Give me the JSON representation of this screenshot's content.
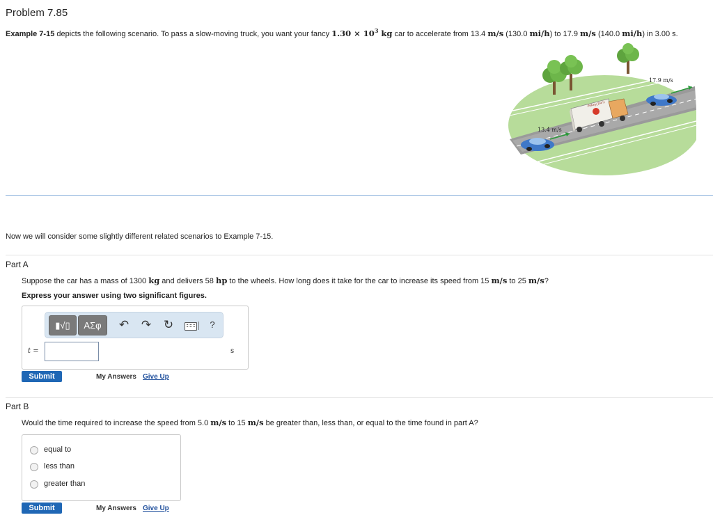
{
  "problem_title": "Problem 7.85",
  "intro": {
    "example_ref": "Example 7-15",
    "text_1": " depicts the following scenario. To pass a slow-moving truck, you want your fancy ",
    "mass": "1.30 × 10",
    "mass_exp": "3",
    "mass_unit": " kg",
    "text_2": " car to accelerate from 13.4 ",
    "ms_1": "m/s",
    "text_3": " (130.0 ",
    "mih_1": "mi/h",
    "text_4": ") to 17.9 ",
    "ms_2": "m/s",
    "text_5": " (140.0 ",
    "mih_2": "mi/h",
    "text_6": ") in 3.00 s."
  },
  "figure": {
    "speed_start": "13.4 m/s",
    "speed_end": "17.9 m/s",
    "truck_label": "Pokey Joe's"
  },
  "transition_text": "Now we will consider some slightly different related scenarios to Example 7-15.",
  "part_a": {
    "label": "Part A",
    "q_1": "Suppose the car has a mass of 1300 ",
    "q_kg": "kg",
    "q_2": " and delivers 58 ",
    "q_hp": "hp",
    "q_3": " to the wheels. How long does it take for the car to increase its speed from 15 ",
    "q_ms1": "m/s",
    "q_4": " to 25 ",
    "q_ms2": "m/s",
    "q_5": "?",
    "instruction": "Express your answer using two significant figures.",
    "toolbar": {
      "templates_label": "▮√▯",
      "symbols_label": "ΑΣφ",
      "help_label": "?"
    },
    "var_label": "t =",
    "answer_value": "",
    "unit": "s",
    "submit": "Submit",
    "my_answers": "My Answers",
    "give_up": "Give Up"
  },
  "part_b": {
    "label": "Part B",
    "q_1": "Would the time required to increase the speed from 5.0 ",
    "q_ms1": "m/s",
    "q_2": " to 15 ",
    "q_ms2": "m/s",
    "q_3": " be greater than, less than, or equal to the time found in part A?",
    "options": [
      "equal to",
      "less than",
      "greater than"
    ],
    "submit": "Submit",
    "my_answers": "My Answers",
    "give_up": "Give Up"
  },
  "colors": {
    "accent": "#1f67b5",
    "toolbar_bg": "#d9e6f2",
    "divider": "#8fb4dd"
  }
}
